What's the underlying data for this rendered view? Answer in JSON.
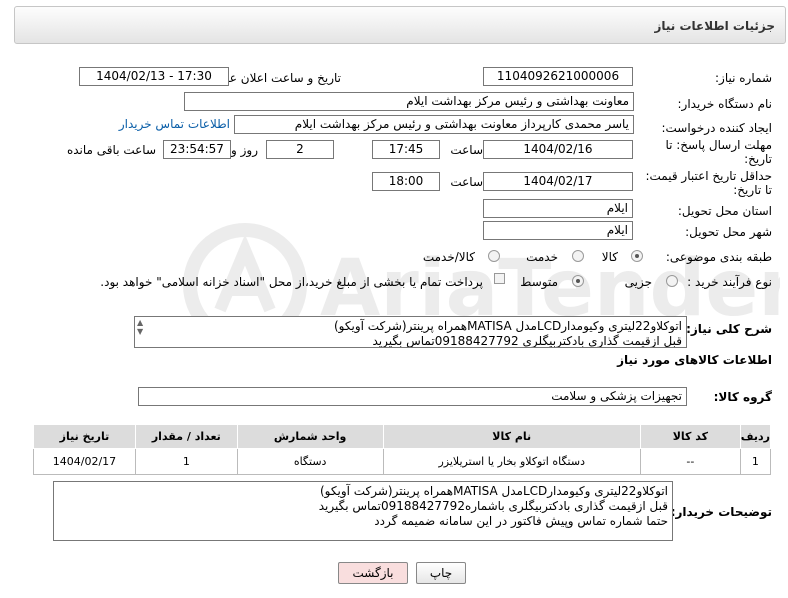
{
  "header": {
    "title": "جزئیات اطلاعات نیاز"
  },
  "fields": {
    "need_number_label": "شماره نیاز:",
    "need_number": "1104092621000006",
    "announce_label": "تاریخ و ساعت اعلان عمومی:",
    "announce_value": "1404/02/13 - 17:30",
    "buyer_org_label": "نام دستگاه خریدار:",
    "buyer_org": "معاونت بهداشتی و رئیس مرکز بهداشت ایلام",
    "creator_label": "ایجاد کننده درخواست:",
    "creator": "یاسر محمدی کارپرداز معاونت بهداشتی و رئیس مرکز بهداشت ایلام",
    "contact_link": "اطلاعات تماس خریدار",
    "reply_deadline_label": "مهلت ارسال پاسخ: تا تاریخ:",
    "reply_date": "1404/02/16",
    "time_label": "ساعت",
    "reply_time": "17:45",
    "days_value": "2",
    "days_label": "روز و",
    "remaining_time": "23:54:57",
    "remaining_label": "ساعت باقی مانده",
    "price_validity_label": "حداقل تاریخ اعتبار قیمت: تا تاریخ:",
    "validity_date": "1404/02/17",
    "validity_time": "18:00",
    "province_label": "استان محل تحویل:",
    "province": "ایلام",
    "city_label": "شهر محل تحویل:",
    "city": "ایلام",
    "category_label": "طبقه بندی موضوعی:",
    "category_options": [
      "کالا",
      "خدمت",
      "کالا/خدمت"
    ],
    "process_label": "نوع فرآیند خرید :",
    "process_options": [
      "جزیی",
      "متوسط"
    ],
    "payment_note": "پرداخت تمام یا بخشی از مبلغ خرید،از محل \"اسناد خزانه اسلامی\" خواهد بود.",
    "description_label": "شرح کلی نیاز:",
    "description_lines": [
      "اتوکلاو22لیتری وکیومدارLCDمدل MATISAهمراه پرینتر(شرکت آویکو)",
      "قبل ازقیمت گذاری بادکتربیگلری 09188427792تماس بگیرید"
    ],
    "goods_info_title": "اطلاعات کالاهای مورد نیاز",
    "goods_group_label": "گروه کالا:",
    "goods_group": "تجهیزات پزشکی و سلامت",
    "buyer_notes_label": "توضیحات خریدار:",
    "buyer_notes_lines": [
      "اتوکلاو22لیتری وکیومدارLCDمدل MATISAهمراه پرینتر(شرکت آویکو)",
      "قبل ازقیمت گذاری بادکتربیگلری باشماره09188427792تماس بگیرید",
      "حتما شماره تماس وپیش فاکتور در این سامانه ضمیمه گردد"
    ]
  },
  "table": {
    "headers": [
      "ردیف",
      "کد کالا",
      "نام کالا",
      "واحد شمارش",
      "تعداد / مقدار",
      "تاریخ نیاز"
    ],
    "rows": [
      [
        "1",
        "--",
        "دستگاه اتوکلاو بخار یا استریلایزر",
        "دستگاه",
        "1",
        "1404/02/17"
      ]
    ]
  },
  "buttons": {
    "print": "چاپ",
    "back": "بازگشت"
  },
  "colors": {
    "link": "#0a5ea8",
    "back_button_bg": "#f9dede",
    "header_bg": "#e4e4e4"
  }
}
